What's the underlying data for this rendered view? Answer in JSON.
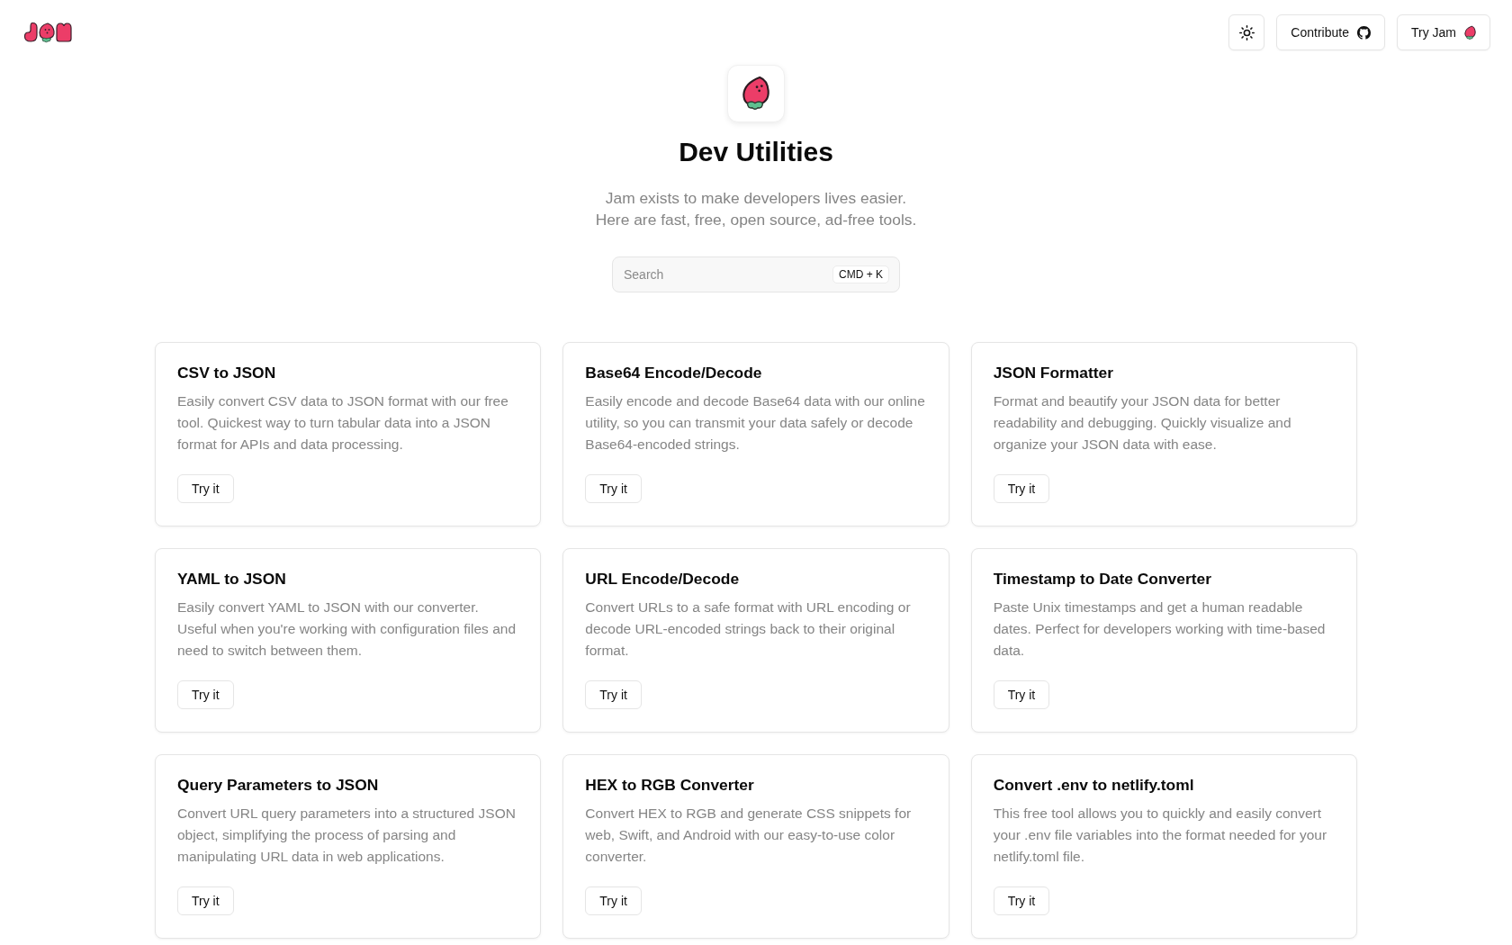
{
  "header": {
    "contribute_button": {
      "label": "Contribute"
    },
    "try_button": {
      "label": "Try Jam"
    }
  },
  "hero": {
    "title": "Dev Utilities",
    "subtitle_lines": [
      "Jam exists to make developers lives easier.",
      "Here are fast, free, open source, ad-free tools."
    ]
  },
  "search": {
    "placeholder": "Search",
    "shortcut": "CMD + K"
  },
  "tools": [
    {
      "title": "CSV to JSON",
      "description": "Easily convert CSV data to JSON format with our free tool. Quickest way to turn tabular data into a JSON format for APIs and data processing.",
      "button": "Try it"
    },
    {
      "title": "Base64 Encode/Decode",
      "description": "Easily encode and decode Base64 data with our online utility, so you can transmit your data safely or decode Base64-encoded strings.",
      "button": "Try it"
    },
    {
      "title": "JSON Formatter",
      "description": "Format and beautify your JSON data for better readability and debugging. Quickly visualize and organize your JSON data with ease.",
      "button": "Try it"
    },
    {
      "title": "YAML to JSON",
      "description": "Easily convert YAML to JSON with our converter. Useful when you're working with configuration files and need to switch between them.",
      "button": "Try it"
    },
    {
      "title": "URL Encode/Decode",
      "description": "Convert URLs to a safe format with URL encoding or decode URL-encoded strings back to their original format.",
      "button": "Try it"
    },
    {
      "title": "Timestamp to Date Converter",
      "description": "Paste Unix timestamps and get a human readable dates. Perfect for developers working with time-based data.",
      "button": "Try it"
    },
    {
      "title": "Query Parameters to JSON",
      "description": "Convert URL query parameters into a structured JSON object, simplifying the process of parsing and manipulating URL data in web applications.",
      "button": "Try it"
    },
    {
      "title": "HEX to RGB Converter",
      "description": "Convert HEX to RGB and generate CSS snippets for web, Swift, and Android with our easy-to-use color converter.",
      "button": "Try it"
    },
    {
      "title": "Convert .env to netlify.toml",
      "description": "This free tool allows you to quickly and easily convert your .env file variables into the format needed for your netlify.toml file.",
      "button": "Try it"
    }
  ]
}
